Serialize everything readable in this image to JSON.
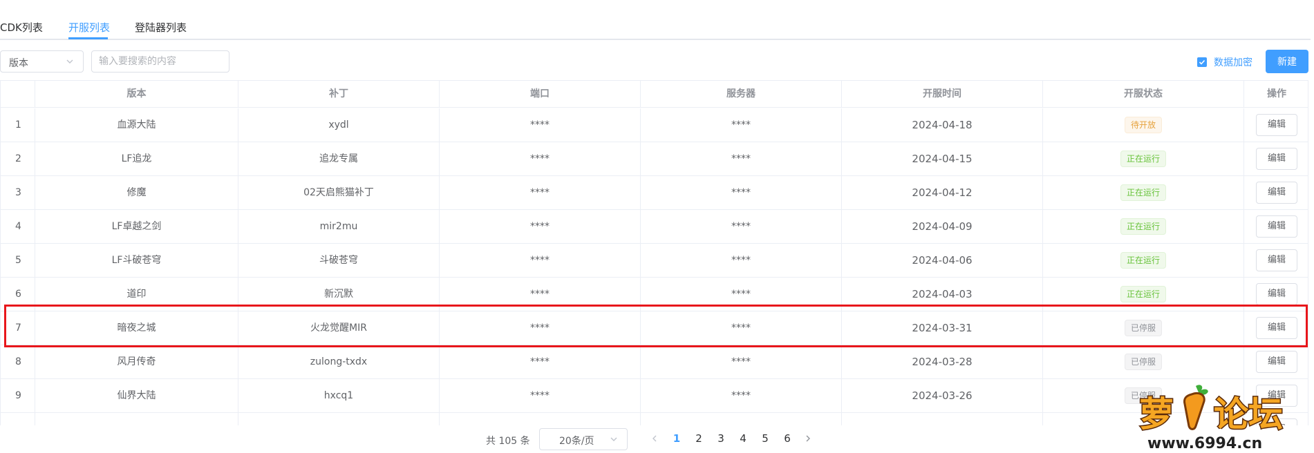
{
  "tabs": [
    {
      "label": "CDK列表",
      "active": false
    },
    {
      "label": "开服列表",
      "active": true
    },
    {
      "label": "登陆器列表",
      "active": false
    }
  ],
  "toolbar": {
    "select_value": "版本",
    "search_placeholder": "输入要搜索的内容",
    "encrypt_label": "数据加密",
    "encrypt_checked": true,
    "new_button": "新建"
  },
  "table": {
    "columns": [
      "",
      "版本",
      "补丁",
      "端口",
      "服务器",
      "开服时间",
      "开服状态",
      "操作"
    ],
    "edit_label": "编辑",
    "rows": [
      {
        "index": "1",
        "version": "血源大陆",
        "patch": "xydl",
        "port": "****",
        "server": "****",
        "date": "2024-04-18",
        "status": "待开放",
        "status_kind": "pending"
      },
      {
        "index": "2",
        "version": "LF追龙",
        "patch": "追龙专属",
        "port": "****",
        "server": "****",
        "date": "2024-04-15",
        "status": "正在运行",
        "status_kind": "running"
      },
      {
        "index": "3",
        "version": "修魔",
        "patch": "02天启熊猫补丁",
        "port": "****",
        "server": "****",
        "date": "2024-04-12",
        "status": "正在运行",
        "status_kind": "running"
      },
      {
        "index": "4",
        "version": "LF卓越之剑",
        "patch": "mir2mu",
        "port": "****",
        "server": "****",
        "date": "2024-04-09",
        "status": "正在运行",
        "status_kind": "running"
      },
      {
        "index": "5",
        "version": "LF斗破苍穹",
        "patch": "斗破苍穹",
        "port": "****",
        "server": "****",
        "date": "2024-04-06",
        "status": "正在运行",
        "status_kind": "running"
      },
      {
        "index": "6",
        "version": "道印",
        "patch": "新沉默",
        "port": "****",
        "server": "****",
        "date": "2024-04-03",
        "status": "正在运行",
        "status_kind": "running"
      },
      {
        "index": "7",
        "version": "暗夜之城",
        "patch": "火龙觉醒MIR",
        "port": "****",
        "server": "****",
        "date": "2024-03-31",
        "status": "已停服",
        "status_kind": "stopped"
      },
      {
        "index": "8",
        "version": "风月传奇",
        "patch": "zulong-txdx",
        "port": "****",
        "server": "****",
        "date": "2024-03-28",
        "status": "已停服",
        "status_kind": "stopped"
      },
      {
        "index": "9",
        "version": "仙界大陆",
        "patch": "hxcq1",
        "port": "****",
        "server": "****",
        "date": "2024-03-26",
        "status": "已停服",
        "status_kind": "stopped"
      },
      {
        "index": "",
        "version": "",
        "patch": "",
        "port": "",
        "server": "",
        "date": "",
        "status": "",
        "status_kind": "stopped"
      }
    ]
  },
  "pagination": {
    "total_text": "共 105 条",
    "page_size": "20条/页",
    "pages": [
      "1",
      "2",
      "3",
      "4",
      "5",
      "6"
    ],
    "current": "1"
  },
  "watermark": {
    "text": "萝卜论坛",
    "url": "www.6994.cn"
  },
  "colors": {
    "accent": "#409eff",
    "highlight": "#e8161b",
    "running": "#67c23a",
    "pending": "#e6a23c",
    "stopped": "#909399"
  }
}
